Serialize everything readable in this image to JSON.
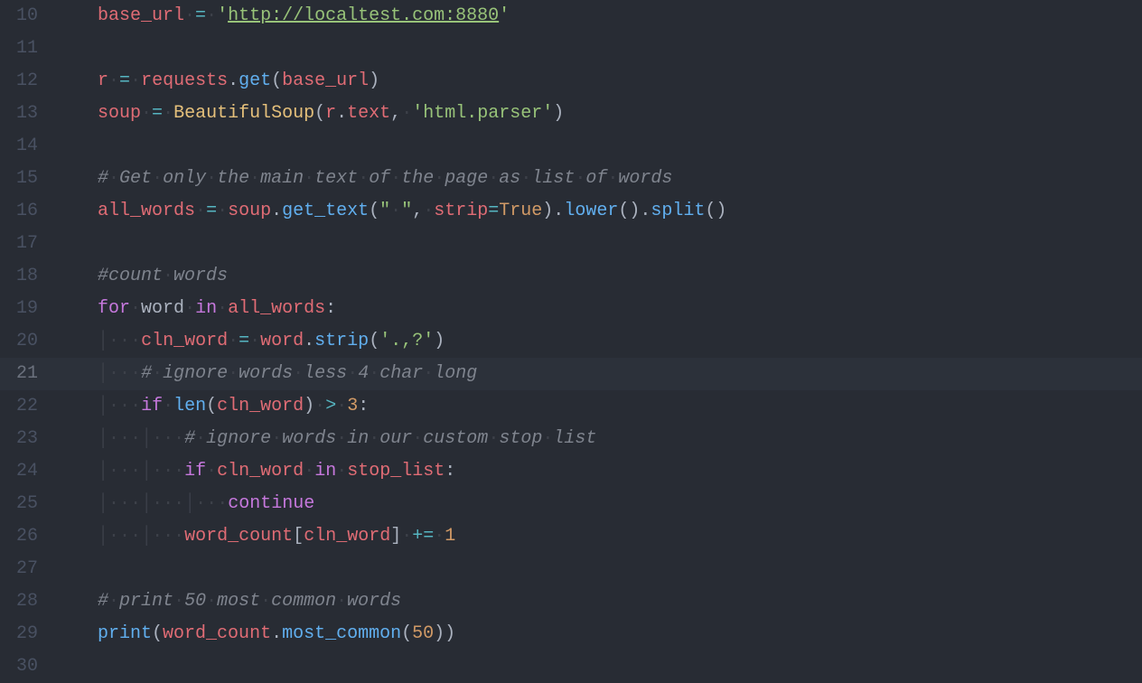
{
  "editor": {
    "active_line": 21,
    "lines": [
      {
        "num": 10,
        "indent": 1,
        "tokens": [
          {
            "t": "base_url",
            "c": "tk-var"
          },
          {
            "t": "·",
            "c": "dot"
          },
          {
            "t": "=",
            "c": "tk-op"
          },
          {
            "t": "·",
            "c": "dot"
          },
          {
            "t": "'",
            "c": "tk-str"
          },
          {
            "t": "http://localtest.com:8880",
            "c": "tk-url"
          },
          {
            "t": "'",
            "c": "tk-str"
          }
        ]
      },
      {
        "num": 11,
        "indent": 0,
        "tokens": []
      },
      {
        "num": 12,
        "indent": 1,
        "tokens": [
          {
            "t": "r",
            "c": "tk-var"
          },
          {
            "t": "·",
            "c": "dot"
          },
          {
            "t": "=",
            "c": "tk-op"
          },
          {
            "t": "·",
            "c": "dot"
          },
          {
            "t": "requests",
            "c": "tk-var"
          },
          {
            "t": ".",
            "c": "tk-plain"
          },
          {
            "t": "get",
            "c": "tk-fn"
          },
          {
            "t": "(",
            "c": "tk-plain"
          },
          {
            "t": "base_url",
            "c": "tk-var"
          },
          {
            "t": ")",
            "c": "tk-plain"
          }
        ]
      },
      {
        "num": 13,
        "indent": 1,
        "tokens": [
          {
            "t": "soup",
            "c": "tk-var"
          },
          {
            "t": "·",
            "c": "dot"
          },
          {
            "t": "=",
            "c": "tk-op"
          },
          {
            "t": "·",
            "c": "dot"
          },
          {
            "t": "BeautifulSoup",
            "c": "tk-cls"
          },
          {
            "t": "(",
            "c": "tk-plain"
          },
          {
            "t": "r",
            "c": "tk-var"
          },
          {
            "t": ".",
            "c": "tk-plain"
          },
          {
            "t": "text",
            "c": "tk-var"
          },
          {
            "t": ",",
            "c": "tk-plain"
          },
          {
            "t": "·",
            "c": "dot"
          },
          {
            "t": "'html.parser'",
            "c": "tk-str"
          },
          {
            "t": ")",
            "c": "tk-plain"
          }
        ]
      },
      {
        "num": 14,
        "indent": 0,
        "tokens": []
      },
      {
        "num": 15,
        "indent": 1,
        "tokens": [
          {
            "t": "#",
            "c": "tk-cmt"
          },
          {
            "t": "·",
            "c": "dot"
          },
          {
            "t": "Get",
            "c": "tk-cmt"
          },
          {
            "t": "·",
            "c": "dot"
          },
          {
            "t": "only",
            "c": "tk-cmt"
          },
          {
            "t": "·",
            "c": "dot"
          },
          {
            "t": "the",
            "c": "tk-cmt"
          },
          {
            "t": "·",
            "c": "dot"
          },
          {
            "t": "main",
            "c": "tk-cmt"
          },
          {
            "t": "·",
            "c": "dot"
          },
          {
            "t": "text",
            "c": "tk-cmt"
          },
          {
            "t": "·",
            "c": "dot"
          },
          {
            "t": "of",
            "c": "tk-cmt"
          },
          {
            "t": "·",
            "c": "dot"
          },
          {
            "t": "the",
            "c": "tk-cmt"
          },
          {
            "t": "·",
            "c": "dot"
          },
          {
            "t": "page",
            "c": "tk-cmt"
          },
          {
            "t": "·",
            "c": "dot"
          },
          {
            "t": "as",
            "c": "tk-cmt"
          },
          {
            "t": "·",
            "c": "dot"
          },
          {
            "t": "list",
            "c": "tk-cmt"
          },
          {
            "t": "·",
            "c": "dot"
          },
          {
            "t": "of",
            "c": "tk-cmt"
          },
          {
            "t": "·",
            "c": "dot"
          },
          {
            "t": "words",
            "c": "tk-cmt"
          }
        ]
      },
      {
        "num": 16,
        "indent": 1,
        "tokens": [
          {
            "t": "all_words",
            "c": "tk-var"
          },
          {
            "t": "·",
            "c": "dot"
          },
          {
            "t": "=",
            "c": "tk-op"
          },
          {
            "t": "·",
            "c": "dot"
          },
          {
            "t": "soup",
            "c": "tk-var"
          },
          {
            "t": ".",
            "c": "tk-plain"
          },
          {
            "t": "get_text",
            "c": "tk-fn"
          },
          {
            "t": "(",
            "c": "tk-plain"
          },
          {
            "t": "\"",
            "c": "tk-str"
          },
          {
            "t": "·",
            "c": "dot"
          },
          {
            "t": "\"",
            "c": "tk-str"
          },
          {
            "t": ",",
            "c": "tk-plain"
          },
          {
            "t": "·",
            "c": "dot"
          },
          {
            "t": "strip",
            "c": "tk-var"
          },
          {
            "t": "=",
            "c": "tk-op"
          },
          {
            "t": "True",
            "c": "tk-bool"
          },
          {
            "t": ")",
            "c": "tk-plain"
          },
          {
            "t": ".",
            "c": "tk-plain"
          },
          {
            "t": "lower",
            "c": "tk-fn"
          },
          {
            "t": "()",
            "c": "tk-plain"
          },
          {
            "t": ".",
            "c": "tk-plain"
          },
          {
            "t": "split",
            "c": "tk-fn"
          },
          {
            "t": "()",
            "c": "tk-plain"
          }
        ]
      },
      {
        "num": 17,
        "indent": 0,
        "tokens": []
      },
      {
        "num": 18,
        "indent": 1,
        "tokens": [
          {
            "t": "#count",
            "c": "tk-cmt"
          },
          {
            "t": "·",
            "c": "dot"
          },
          {
            "t": "words",
            "c": "tk-cmt"
          }
        ]
      },
      {
        "num": 19,
        "indent": 1,
        "tokens": [
          {
            "t": "for",
            "c": "tk-kw"
          },
          {
            "t": "·",
            "c": "dot"
          },
          {
            "t": "word",
            "c": "tk-plain"
          },
          {
            "t": "·",
            "c": "dot"
          },
          {
            "t": "in",
            "c": "tk-kw"
          },
          {
            "t": "·",
            "c": "dot"
          },
          {
            "t": "all_words",
            "c": "tk-var"
          },
          {
            "t": ":",
            "c": "tk-plain"
          }
        ]
      },
      {
        "num": 20,
        "indent": 1,
        "tokens": [
          {
            "t": "│",
            "c": "guide"
          },
          {
            "t": "·",
            "c": "dot"
          },
          {
            "t": "·",
            "c": "dot"
          },
          {
            "t": "·",
            "c": "dot"
          },
          {
            "t": "cln_word",
            "c": "tk-var"
          },
          {
            "t": "·",
            "c": "dot"
          },
          {
            "t": "=",
            "c": "tk-op"
          },
          {
            "t": "·",
            "c": "dot"
          },
          {
            "t": "word",
            "c": "tk-var"
          },
          {
            "t": ".",
            "c": "tk-plain"
          },
          {
            "t": "strip",
            "c": "tk-fn"
          },
          {
            "t": "(",
            "c": "tk-plain"
          },
          {
            "t": "'.,?'",
            "c": "tk-str"
          },
          {
            "t": ")",
            "c": "tk-plain"
          }
        ]
      },
      {
        "num": 21,
        "indent": 1,
        "tokens": [
          {
            "t": "│",
            "c": "guide"
          },
          {
            "t": "·",
            "c": "dot"
          },
          {
            "t": "·",
            "c": "dot"
          },
          {
            "t": "·",
            "c": "dot"
          },
          {
            "t": "#",
            "c": "tk-cmt"
          },
          {
            "t": "·",
            "c": "dot"
          },
          {
            "t": "ignore",
            "c": "tk-cmt"
          },
          {
            "t": "·",
            "c": "dot"
          },
          {
            "t": "words",
            "c": "tk-cmt"
          },
          {
            "t": "·",
            "c": "dot"
          },
          {
            "t": "less",
            "c": "tk-cmt"
          },
          {
            "t": "·",
            "c": "dot"
          },
          {
            "t": "4",
            "c": "tk-cmt"
          },
          {
            "t": "·",
            "c": "dot"
          },
          {
            "t": "char",
            "c": "tk-cmt"
          },
          {
            "t": "·",
            "c": "dot"
          },
          {
            "t": "long",
            "c": "tk-cmt"
          }
        ]
      },
      {
        "num": 22,
        "indent": 1,
        "tokens": [
          {
            "t": "│",
            "c": "guide"
          },
          {
            "t": "·",
            "c": "dot"
          },
          {
            "t": "·",
            "c": "dot"
          },
          {
            "t": "·",
            "c": "dot"
          },
          {
            "t": "if",
            "c": "tk-kw"
          },
          {
            "t": "·",
            "c": "dot"
          },
          {
            "t": "len",
            "c": "tk-fn"
          },
          {
            "t": "(",
            "c": "tk-plain"
          },
          {
            "t": "cln_word",
            "c": "tk-var"
          },
          {
            "t": ")",
            "c": "tk-plain"
          },
          {
            "t": "·",
            "c": "dot"
          },
          {
            "t": ">",
            "c": "tk-op"
          },
          {
            "t": "·",
            "c": "dot"
          },
          {
            "t": "3",
            "c": "tk-num"
          },
          {
            "t": ":",
            "c": "tk-plain"
          }
        ]
      },
      {
        "num": 23,
        "indent": 1,
        "tokens": [
          {
            "t": "│",
            "c": "guide"
          },
          {
            "t": "·",
            "c": "dot"
          },
          {
            "t": "·",
            "c": "dot"
          },
          {
            "t": "·",
            "c": "dot"
          },
          {
            "t": "│",
            "c": "guide"
          },
          {
            "t": "·",
            "c": "dot"
          },
          {
            "t": "·",
            "c": "dot"
          },
          {
            "t": "·",
            "c": "dot"
          },
          {
            "t": "#",
            "c": "tk-cmt"
          },
          {
            "t": "·",
            "c": "dot"
          },
          {
            "t": "ignore",
            "c": "tk-cmt"
          },
          {
            "t": "·",
            "c": "dot"
          },
          {
            "t": "words",
            "c": "tk-cmt"
          },
          {
            "t": "·",
            "c": "dot"
          },
          {
            "t": "in",
            "c": "tk-cmt"
          },
          {
            "t": "·",
            "c": "dot"
          },
          {
            "t": "our",
            "c": "tk-cmt"
          },
          {
            "t": "·",
            "c": "dot"
          },
          {
            "t": "custom",
            "c": "tk-cmt"
          },
          {
            "t": "·",
            "c": "dot"
          },
          {
            "t": "stop",
            "c": "tk-cmt"
          },
          {
            "t": "·",
            "c": "dot"
          },
          {
            "t": "list",
            "c": "tk-cmt"
          }
        ]
      },
      {
        "num": 24,
        "indent": 1,
        "tokens": [
          {
            "t": "│",
            "c": "guide"
          },
          {
            "t": "·",
            "c": "dot"
          },
          {
            "t": "·",
            "c": "dot"
          },
          {
            "t": "·",
            "c": "dot"
          },
          {
            "t": "│",
            "c": "guide"
          },
          {
            "t": "·",
            "c": "dot"
          },
          {
            "t": "·",
            "c": "dot"
          },
          {
            "t": "·",
            "c": "dot"
          },
          {
            "t": "if",
            "c": "tk-kw"
          },
          {
            "t": "·",
            "c": "dot"
          },
          {
            "t": "cln_word",
            "c": "tk-var"
          },
          {
            "t": "·",
            "c": "dot"
          },
          {
            "t": "in",
            "c": "tk-kw"
          },
          {
            "t": "·",
            "c": "dot"
          },
          {
            "t": "stop_list",
            "c": "tk-var"
          },
          {
            "t": ":",
            "c": "tk-plain"
          }
        ]
      },
      {
        "num": 25,
        "indent": 1,
        "tokens": [
          {
            "t": "│",
            "c": "guide"
          },
          {
            "t": "·",
            "c": "dot"
          },
          {
            "t": "·",
            "c": "dot"
          },
          {
            "t": "·",
            "c": "dot"
          },
          {
            "t": "│",
            "c": "guide"
          },
          {
            "t": "·",
            "c": "dot"
          },
          {
            "t": "·",
            "c": "dot"
          },
          {
            "t": "·",
            "c": "dot"
          },
          {
            "t": "│",
            "c": "guide"
          },
          {
            "t": "·",
            "c": "dot"
          },
          {
            "t": "·",
            "c": "dot"
          },
          {
            "t": "·",
            "c": "dot"
          },
          {
            "t": "continue",
            "c": "tk-kw"
          }
        ]
      },
      {
        "num": 26,
        "indent": 1,
        "tokens": [
          {
            "t": "│",
            "c": "guide"
          },
          {
            "t": "·",
            "c": "dot"
          },
          {
            "t": "·",
            "c": "dot"
          },
          {
            "t": "·",
            "c": "dot"
          },
          {
            "t": "│",
            "c": "guide"
          },
          {
            "t": "·",
            "c": "dot"
          },
          {
            "t": "·",
            "c": "dot"
          },
          {
            "t": "·",
            "c": "dot"
          },
          {
            "t": "word_count",
            "c": "tk-var"
          },
          {
            "t": "[",
            "c": "tk-plain"
          },
          {
            "t": "cln_word",
            "c": "tk-var"
          },
          {
            "t": "]",
            "c": "tk-plain"
          },
          {
            "t": "·",
            "c": "dot"
          },
          {
            "t": "+=",
            "c": "tk-op"
          },
          {
            "t": "·",
            "c": "dot"
          },
          {
            "t": "1",
            "c": "tk-num"
          }
        ]
      },
      {
        "num": 27,
        "indent": 0,
        "tokens": []
      },
      {
        "num": 28,
        "indent": 1,
        "tokens": [
          {
            "t": "#",
            "c": "tk-cmt"
          },
          {
            "t": "·",
            "c": "dot"
          },
          {
            "t": "print",
            "c": "tk-cmt"
          },
          {
            "t": "·",
            "c": "dot"
          },
          {
            "t": "50",
            "c": "tk-cmt"
          },
          {
            "t": "·",
            "c": "dot"
          },
          {
            "t": "most",
            "c": "tk-cmt"
          },
          {
            "t": "·",
            "c": "dot"
          },
          {
            "t": "common",
            "c": "tk-cmt"
          },
          {
            "t": "·",
            "c": "dot"
          },
          {
            "t": "words",
            "c": "tk-cmt"
          }
        ]
      },
      {
        "num": 29,
        "indent": 1,
        "tokens": [
          {
            "t": "print",
            "c": "tk-fn"
          },
          {
            "t": "(",
            "c": "tk-plain"
          },
          {
            "t": "word_count",
            "c": "tk-var"
          },
          {
            "t": ".",
            "c": "tk-plain"
          },
          {
            "t": "most_common",
            "c": "tk-fn"
          },
          {
            "t": "(",
            "c": "tk-plain"
          },
          {
            "t": "50",
            "c": "tk-num"
          },
          {
            "t": ")",
            "c": "tk-plain"
          },
          {
            "t": ")",
            "c": "tk-plain"
          }
        ]
      },
      {
        "num": 30,
        "indent": 0,
        "tokens": []
      }
    ]
  }
}
